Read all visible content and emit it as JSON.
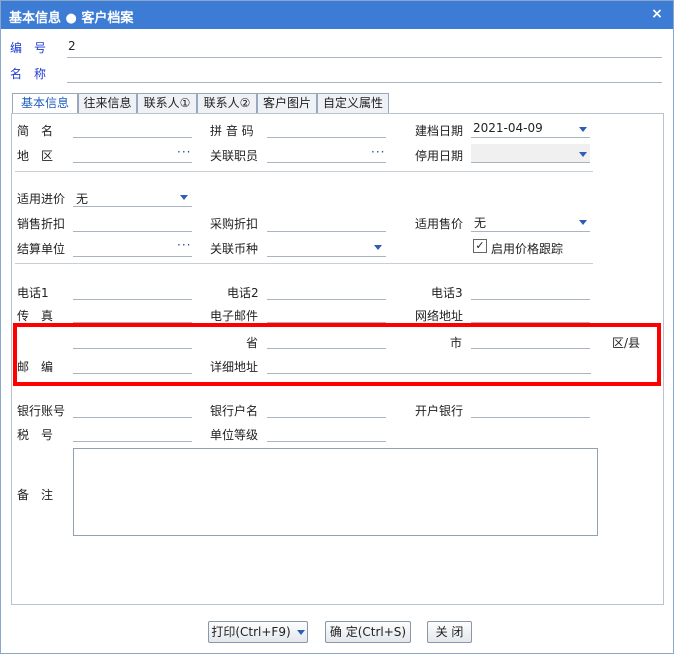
{
  "window": {
    "title": "基本信息 ● 客户档案",
    "close_glyph": "×"
  },
  "header": {
    "code_label": "编　号",
    "code_value": "2",
    "name_label": "名　称",
    "name_value": ""
  },
  "tabs": [
    {
      "label": "基本信息"
    },
    {
      "label": "往来信息"
    },
    {
      "label": "联系人①"
    },
    {
      "label": "联系人②"
    },
    {
      "label": "客户图片"
    },
    {
      "label": "自定义属性"
    }
  ],
  "form": {
    "short_name": "简　名",
    "pinyin": "拼 音 码",
    "created_date_label": "建档日期",
    "created_date_value": "2021-04-09",
    "region": "地　区",
    "related_staff": "关联职员",
    "disabled_date": "停用日期",
    "use_purchase_price": "适用进价",
    "use_purchase_price_value": "无",
    "sales_discount": "销售折扣",
    "purchase_discount": "采购折扣",
    "use_sale_price": "适用售价",
    "use_sale_price_value": "无",
    "settlement_unit": "结算单位",
    "related_currency": "关联币种",
    "price_tracking": "启用价格跟踪",
    "phone1": "电话1",
    "phone2": "电话2",
    "phone3": "电话3",
    "fax": "传　真",
    "email": "电子邮件",
    "website": "网络地址",
    "province": "省",
    "city": "市",
    "district": "区/县",
    "postcode": "邮　编",
    "address_detail": "详细地址",
    "bank_account": "银行账号",
    "bank_holder": "银行户名",
    "bank_name": "开户银行",
    "tax_no": "税　号",
    "unit_level": "单位等级",
    "remark": "备　注",
    "check_mark": "✓"
  },
  "footer": {
    "print": "打印(Ctrl+F9)",
    "confirm": "确 定(Ctrl+S)",
    "close": "关 闭"
  },
  "colors": {
    "title_bg": "#3d7cd4",
    "highlight": "#ff0000",
    "label_blue": "#1f3bd1"
  }
}
